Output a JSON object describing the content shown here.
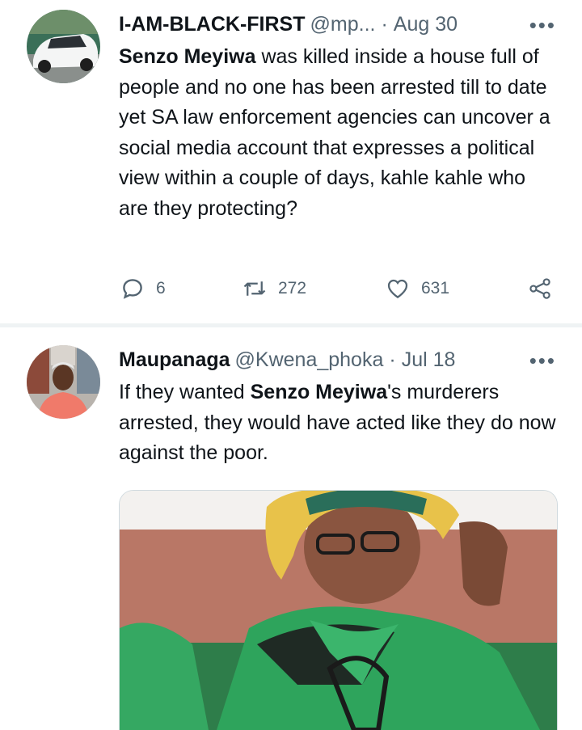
{
  "tweets": [
    {
      "name": "I-AM-BLACK-FIRST",
      "handle": "@mp...",
      "dot": "·",
      "date": "Aug 30",
      "text_bold": "Senzo Meyiwa",
      "text_rest": " was killed inside a house full of people and no one has been arrested till to date yet SA law enforcement agencies can uncover a social media account that expresses a political view within a couple of days, kahle kahle who are they protecting?",
      "replies": "6",
      "retweets": "272",
      "likes": "631"
    },
    {
      "name": "Maupanaga",
      "handle": "@Kwena_phoka",
      "dot": "·",
      "date": "Jul 18",
      "text_pre": "If they wanted ",
      "text_bold": "Senzo Meyiwa",
      "text_post": "'s murderers arrested, they would have acted like they do now against the poor."
    }
  ],
  "icons": {
    "more": "more-icon",
    "reply": "reply-icon",
    "retweet": "retweet-icon",
    "like": "like-icon",
    "share": "share-icon"
  },
  "colors": {
    "text": "#0f1419",
    "secondary": "#536471",
    "divider": "#eff3f4"
  }
}
